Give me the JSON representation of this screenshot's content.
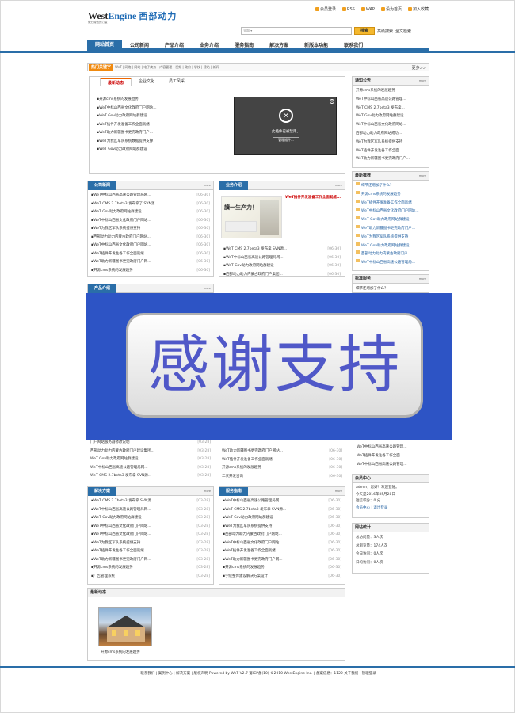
{
  "logo": {
    "en_a": "West",
    "en_b": "Engine",
    "cn": "西部动力",
    "sub": "微分诚信的力量"
  },
  "toplinks": [
    "会员登录",
    "RSS",
    "WAP",
    "设为首页",
    "加入收藏"
  ],
  "search": {
    "select": "全部",
    "button": "搜索",
    "adv": "高级搜索",
    "fulltext": "全文检索"
  },
  "nav": [
    "网站首页",
    "公司新闻",
    "产品介绍",
    "业务介绍",
    "服务指南",
    "解决方案",
    "新版本功能",
    "联系我们"
  ],
  "hot": {
    "tag": "热门关键字",
    "keywords": "WeT | 网络 | 网站 | 电子商务 | 内容管理 | 视频 | 政府 | 学校 | 建站 | 新闻",
    "more": "更多>>"
  },
  "tabs": [
    "最新动态",
    "企业文化",
    "员工风采"
  ],
  "latest": [
    {
      "t": "开源cms系统的发展趋势",
      "d": "[06-30]"
    },
    {
      "t": "WeT中标山西省文化政府门户网站...",
      "d": "[06-30]"
    },
    {
      "t": "WeT Gov助力政府网站群建设",
      "d": "[06-30]"
    },
    {
      "t": "WeT插件开发准备工作全面就绪",
      "d": "[06-30]"
    },
    {
      "t": "WeT助力新疆图书更完政府门户...",
      "d": "[06-30]"
    },
    {
      "t": "WeT为我区军队系统数据提供支撑",
      "d": "[06-30]"
    },
    {
      "t": "WeT Gov助力政府网站群建设",
      "d": "[06-30]"
    }
  ],
  "plugin": {
    "msg": "此插件已被禁用。",
    "btn": "管理插件..."
  },
  "notice": {
    "title": "通知公告",
    "more": "more",
    "items": [
      "开源cms系统的发展趋势",
      "WeT中标山西省高速公路管理...",
      "WeT CMS 2.7beta3 发布拿...",
      "WeT Gov助力政府网站群建设",
      "WeT中标山西省文化政府网站...",
      "西部动力助力政府网站成功...",
      "WeT为我区军队系统提供支持",
      "WeT插件开发准备工作全面...",
      "WeT助力新疆图书更完政府门户...",
      "WeT中标山西省高速公路管理...",
      "开源cms系统的发展趋势"
    ]
  },
  "company_news": {
    "title": "公司新闻",
    "more": "more",
    "items": [
      {
        "t": "WeT中标山西省高速公路管理局网...",
        "d": "[06-30]"
      },
      {
        "t": "WeT CMS 2.7beta3 发布拿了 SVN源...",
        "d": "[06-30]"
      },
      {
        "t": "WeT Gov助力政府网站群建设",
        "d": "[06-30]"
      },
      {
        "t": "WeT中标山西省文化政府门户网站...",
        "d": "[06-30]"
      },
      {
        "t": "WeT为我区军队系统提供支持",
        "d": "[06-30]"
      },
      {
        "t": "西部动力助力内蒙古政府门户网站...",
        "d": "[06-30]"
      },
      {
        "t": "WeT中标山西省文化政府门户网站...",
        "d": "[06-30]"
      },
      {
        "t": "WeT插件开发准备工作全面就绪",
        "d": "[06-30]"
      },
      {
        "t": "WeT助力新疆图书更完政府门户网...",
        "d": "[06-30]"
      },
      {
        "t": "开源cms系统的发展趋势",
        "d": "[06-30]"
      },
      {
        "t": "WeT Gov协同研发系统服务设计系统",
        "d": "[06-30]"
      }
    ]
  },
  "business": {
    "title": "业务介绍",
    "more": "more",
    "headline": "WeT插件开发准备工作全面就绪...",
    "pic_text": "讀一生产力！",
    "items": [
      {
        "t": "WeT CMS 2.7beta3 发布拿 SVN源...",
        "d": "[06-30]"
      },
      {
        "t": "WeT中标山西省高速公路管理局网...",
        "d": "[06-30]"
      },
      {
        "t": "WeT Gov助力政府网站群建设",
        "d": "[06-30]"
      },
      {
        "t": "西部动力助力内蒙古政府门户集团...",
        "d": "[06-30]"
      }
    ]
  },
  "recommend": {
    "title": "最新推荐",
    "more": "more",
    "items": [
      "细节还增加了什么？",
      "开源cms系统的发展趋势",
      "WeT插件开发准备工作全面就绪",
      "WeT中标山西省文化政府门户网站...",
      "WeT Gov助力政府网站群建设",
      "WeT助力新疆图书更完政府门户...",
      "WeT为我区军队系统提供支持",
      "WeT Gov助力政府网站群建设",
      "西部动力助力内蒙古政府门户...",
      "WeT中标山西省高速公路管理局...",
      "WeT CMS 2.7beta3 发布拿 SVN..."
    ]
  },
  "standard": {
    "title": "标准服务",
    "more": "more",
    "items": [
      "细节还增加了什么？"
    ]
  },
  "product": {
    "title": "产品介绍",
    "more": "more"
  },
  "overlay": {
    "text": "感谢支持"
  },
  "mid_left": {
    "items": [
      {
        "t": "门户网站服务器修改说明",
        "d": "[03-28]"
      },
      {
        "t": "西部动力助力内蒙古政府门户建设集团...",
        "d": "[03-28]"
      },
      {
        "t": "WeT Gov助力政府网站群建设",
        "d": "[03-28]"
      },
      {
        "t": "WeT中标山西省高速公路管理局网...",
        "d": "[03-28]"
      },
      {
        "t": "WeT CMS 2.7beta3 发布拿 SVN源...",
        "d": "[03-28]"
      }
    ]
  },
  "mid_right": {
    "items": [
      {
        "t": "WeT助力新疆图书更完政府门户网站...",
        "d": "[06-30]"
      },
      {
        "t": "WeT插件开发准备工作全面就绪",
        "d": "[06-30]"
      },
      {
        "t": "开源cms系统的发展趋势",
        "d": "[06-30]"
      },
      {
        "t": "二次开发咨询",
        "d": "[06-30]"
      }
    ]
  },
  "right_mid": {
    "items": [
      "WeT中标山西省高速公路管理...",
      "WeT插件开发准备工作全面...",
      "WeT中标山西省高速公路管理..."
    ]
  },
  "solutions": {
    "title": "解决方案",
    "more": "more",
    "items": [
      {
        "t": "WeT CMS 2.7beta3 发布拿 SVN源...",
        "d": "[03-28]"
      },
      {
        "t": "WeT中标山西省高速公路管理局网...",
        "d": "[03-28]"
      },
      {
        "t": "WeT Gov助力政府网站群建设",
        "d": "[03-28]"
      },
      {
        "t": "WeT中标山西省文化政府门户网站...",
        "d": "[03-28]"
      },
      {
        "t": "WeT中标山西省文化政府门户网站...",
        "d": "[03-28]"
      },
      {
        "t": "WeT为我区军队系统提供支持",
        "d": "[03-28]"
      },
      {
        "t": "WeT插件开发准备工作全面就绪",
        "d": "[03-28]"
      },
      {
        "t": "WeT助力新疆图书更完政府门户网...",
        "d": "[03-28]"
      },
      {
        "t": "开源cms系统的发展趋势",
        "d": "[03-28]"
      },
      {
        "t": "广告管理系统",
        "d": "[03-28]"
      }
    ]
  },
  "service_guide": {
    "title": "服务指南",
    "more": "more",
    "items": [
      {
        "t": "WeT中标山西省高速公路管理局网...",
        "d": "[06-30]"
      },
      {
        "t": "WeT CMS 2.7beta3 发布拿 SVN源...",
        "d": "[06-30]"
      },
      {
        "t": "WeT Gov助力政府网站群建设",
        "d": "[06-30]"
      },
      {
        "t": "WeT为我区军队系统提供支持",
        "d": "[06-30]"
      },
      {
        "t": "西部动力助力内蒙古政府门户网站...",
        "d": "[06-30]"
      },
      {
        "t": "WeT中标山西省文化政府门户网站...",
        "d": "[06-30]"
      },
      {
        "t": "WeT插件开发准备工作全面就绪",
        "d": "[06-30]"
      },
      {
        "t": "WeT助力新疆图书更完政府门户网...",
        "d": "[06-30]"
      },
      {
        "t": "开源cms系统的发展趋势",
        "d": "[06-30]"
      },
      {
        "t": "学院整体建设解决方案设计",
        "d": "[06-30]"
      }
    ]
  },
  "member": {
    "title": "会员中心",
    "lines": [
      "admin，您好！欢迎登陆。",
      "今天是2016年05月28日",
      "短信积分：0 分",
      "会员中心 | 退出登录"
    ]
  },
  "stats": {
    "title": "网站统计",
    "lines": [
      "总访问量：3人次",
      "总浏览量：174人次",
      "今日访问：0人次",
      "日均访问：0人次"
    ]
  },
  "latest_news": {
    "title": "最新动态",
    "caption": "开源cms系统的发展趋势"
  },
  "footer": "联系我们 | 案例中心 | 解决方案 | 版权声明 Powered by WeT V2.7 蜀ICP备(10) ©2010 WestEngine Inc. | 备案信息：1122 关于我们 | 管理登录"
}
